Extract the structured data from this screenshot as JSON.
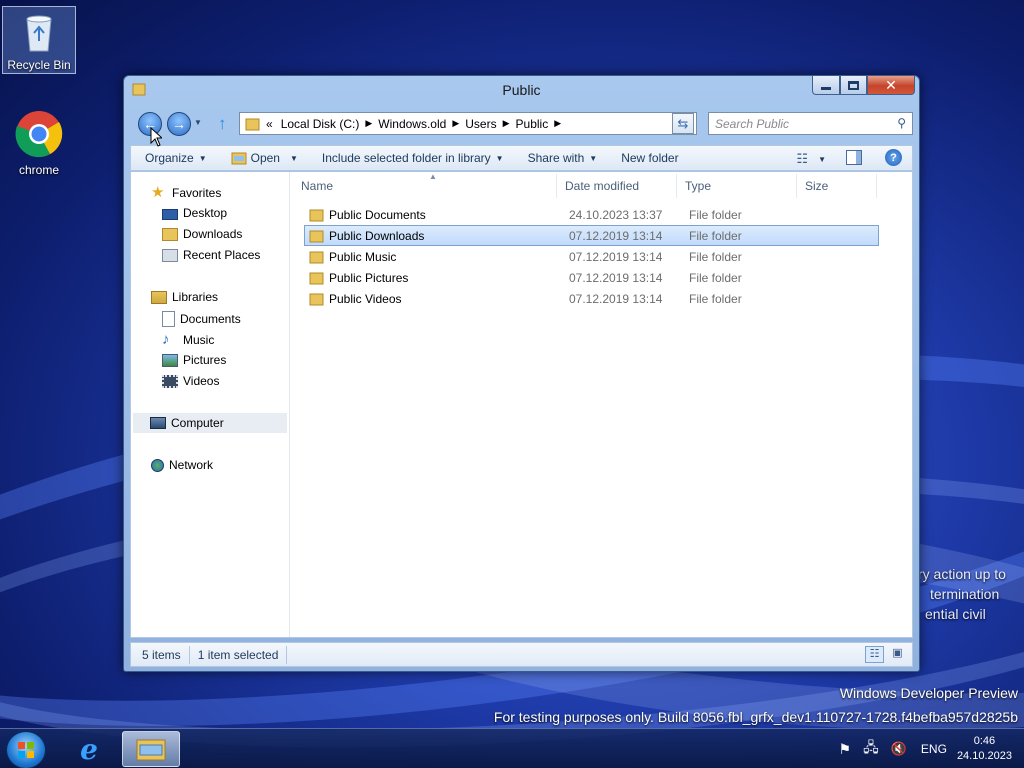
{
  "desktop": {
    "icons": [
      {
        "label": "Recycle Bin"
      },
      {
        "label": "chrome"
      }
    ],
    "watermark": {
      "line1": "Windows Developer Preview",
      "line2": "For testing purposes only. Build 8056.fbl_grfx_dev1.110727-1728.f4befba957d2825b"
    },
    "partial_text": [
      "ry action up to",
      "termination",
      "ential civil"
    ]
  },
  "window": {
    "title": "Public",
    "address": {
      "overflow": "«",
      "crumbs": [
        "Local Disk (C:)",
        "Windows.old",
        "Users",
        "Public"
      ]
    },
    "search_placeholder": "Search Public",
    "commands": {
      "organize": "Organize",
      "open": "Open",
      "include": "Include selected folder in library",
      "share": "Share with",
      "new_folder": "New folder"
    },
    "nav": {
      "favorites": "Favorites",
      "desktop": "Desktop",
      "downloads": "Downloads",
      "recent": "Recent Places",
      "libraries": "Libraries",
      "documents": "Documents",
      "music": "Music",
      "pictures": "Pictures",
      "videos": "Videos",
      "computer": "Computer",
      "network": "Network"
    },
    "columns": {
      "name": "Name",
      "date": "Date modified",
      "type": "Type",
      "size": "Size"
    },
    "files": [
      {
        "name": "Public Documents",
        "date": "24.10.2023 13:37",
        "type": "File folder"
      },
      {
        "name": "Public Downloads",
        "date": "07.12.2019 13:14",
        "type": "File folder"
      },
      {
        "name": "Public Music",
        "date": "07.12.2019 13:14",
        "type": "File folder"
      },
      {
        "name": "Public Pictures",
        "date": "07.12.2019 13:14",
        "type": "File folder"
      },
      {
        "name": "Public Videos",
        "date": "07.12.2019 13:14",
        "type": "File folder"
      }
    ],
    "status": {
      "items": "5 items",
      "selected": "1 item selected"
    }
  },
  "taskbar": {
    "language": "ENG",
    "time": "0:46",
    "date": "24.10.2023"
  },
  "colors": {
    "folder": "#e8c45a",
    "selection": "#c1dbfc",
    "accent": "#1e395b"
  }
}
